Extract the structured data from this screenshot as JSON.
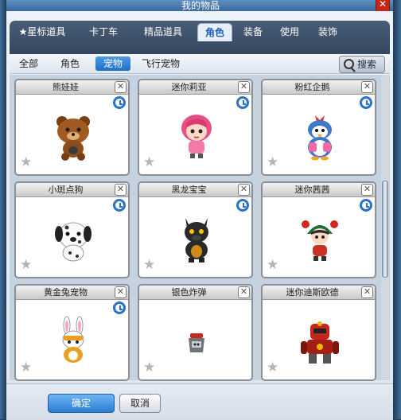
{
  "window": {
    "title": "我的物品",
    "close_label": "✕"
  },
  "tabs": [
    {
      "label": "★星标道具"
    },
    {
      "label": "卡丁车"
    },
    {
      "label": "精品道具"
    },
    {
      "label": "角色"
    },
    {
      "label": "装备"
    },
    {
      "label": "使用"
    },
    {
      "label": "装饰"
    }
  ],
  "active_tab": "角色",
  "subtabs": [
    {
      "label": "全部"
    },
    {
      "label": "角色"
    },
    {
      "label": "宠物"
    },
    {
      "label": "飞行宠物"
    }
  ],
  "active_subtab": "宠物",
  "search": {
    "label": "搜索",
    "icon": "magnifier-icon"
  },
  "items": [
    {
      "name": "熊娃娃",
      "icon": "bear-pet-icon",
      "timed": true
    },
    {
      "name": "迷你莉亚",
      "icon": "mini-lia-pet-icon",
      "timed": true
    },
    {
      "name": "粉红企鹅",
      "icon": "pink-penguin-pet-icon",
      "timed": true
    },
    {
      "name": "小斑点狗",
      "icon": "dalmatian-pet-icon",
      "timed": true
    },
    {
      "name": "黑龙宝宝",
      "icon": "black-dragon-pet-icon",
      "timed": true
    },
    {
      "name": "迷你茜茜",
      "icon": "mini-xixi-pet-icon",
      "timed": true
    },
    {
      "name": "黄金兔宠物",
      "icon": "golden-rabbit-pet-icon",
      "timed": true
    },
    {
      "name": "银色炸弹",
      "icon": "silver-bomb-pet-icon",
      "timed": false
    },
    {
      "name": "迷你迪斯欧德",
      "icon": "mini-robot-pet-icon",
      "timed": false
    }
  ],
  "card_close_label": "✕",
  "star_glyph": "★",
  "footer": {
    "ok_label": "确定",
    "cancel_label": "取消"
  },
  "colors": {
    "accent": "#2b7dd3",
    "tabbar": "#3d5069",
    "clock": "#2b72c9"
  }
}
